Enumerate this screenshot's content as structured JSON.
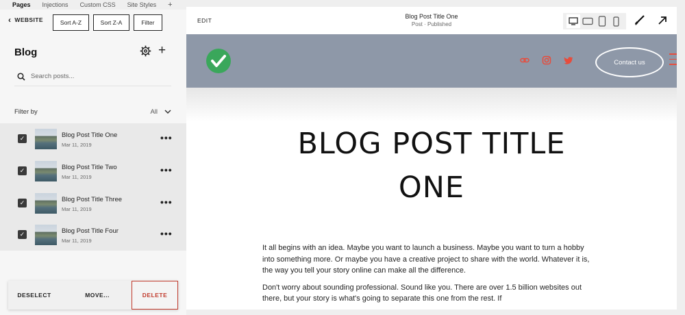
{
  "top_tabs": [
    "Pages",
    "Injections",
    "Custom CSS",
    "Site Styles"
  ],
  "toolbar": {
    "back_label": "WEBSITE",
    "sort_az": "Sort A-Z",
    "sort_za": "Sort Z-A",
    "filter": "Filter"
  },
  "blog": {
    "title": "Blog",
    "search_placeholder": "Search posts...",
    "filter_label": "Filter by",
    "filter_value": "All"
  },
  "posts": [
    {
      "title": "Blog Post Title One",
      "date": "Mar 11, 2019",
      "checked": true
    },
    {
      "title": "Blog Post Title Two",
      "date": "Mar 11, 2019",
      "checked": true
    },
    {
      "title": "Blog Post Title Three",
      "date": "Mar 11, 2019",
      "checked": true
    },
    {
      "title": "Blog Post Title Four",
      "date": "Mar 11, 2019",
      "checked": true
    }
  ],
  "actions": {
    "deselect": "DESELECT",
    "move": "MOVE...",
    "delete": "DELETE"
  },
  "preview": {
    "edit": "EDIT",
    "title": "Blog Post Title One",
    "status": "Post · Published",
    "contact": "Contact us",
    "heading_line1": "BLOG POST TITLE",
    "heading_line2": "ONE",
    "paragraph1": "It all begins with an idea. Maybe you want to launch a business. Maybe you want to turn a hobby into something more. Or maybe you have a creative project to share with the world. Whatever it is, the way you tell your story online can make all the difference.",
    "paragraph2": "Don't worry about sounding professional. Sound like you. There are over 1.5 billion websites out there, but your story is what's going to separate this one from the rest. If"
  },
  "colors": {
    "header_bg": "#8e98a8",
    "accent_red": "#e74c3c",
    "logo_green": "#3aa75b",
    "delete_red": "#c0392b"
  },
  "icons": [
    "chevron-left-icon",
    "gear-icon",
    "plus-icon",
    "search-icon",
    "chevron-down-icon",
    "checkbox-icon",
    "more-icon",
    "desktop-icon",
    "tablet-landscape-icon",
    "tablet-portrait-icon",
    "mobile-icon",
    "brush-icon",
    "external-link-icon",
    "checkmark-logo-icon",
    "link-icon",
    "instagram-icon",
    "twitter-icon",
    "hamburger-icon"
  ]
}
